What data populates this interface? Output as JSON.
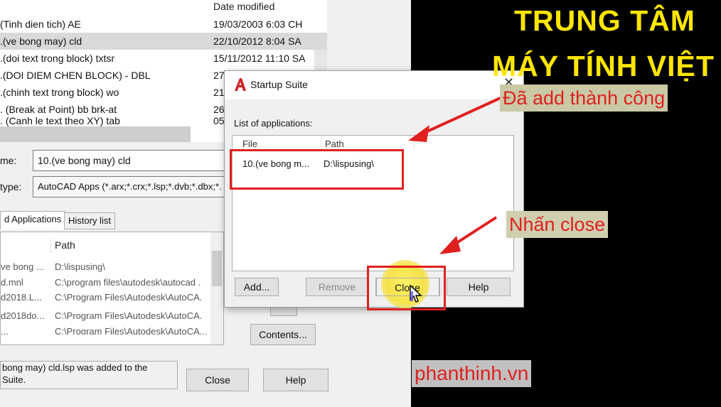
{
  "background_dialog": {
    "table": {
      "date_header": "Date modified",
      "rows": [
        {
          "name": "(Tinh dien tich) AE",
          "date": "19/03/2003 6:03 CH"
        },
        {
          "name": ".(ve bong may) cld",
          "date": "22/10/2012 8:04 SA",
          "selected": true
        },
        {
          "name": ".(doi text trong block) txtsr",
          "date": "15/11/2012 11:10 SA"
        },
        {
          "name": ".(DOI DIEM CHEN BLOCK) - DBL",
          "date": "27"
        },
        {
          "name": ".(chinh text trong block) wo",
          "date": "21"
        },
        {
          "name": ". (Break at Point) bb brk-at",
          "date": "26"
        },
        {
          "name": ". (Canh le text theo XY) tab",
          "date": "05"
        }
      ]
    },
    "file_name_label": "me:",
    "file_name_value": "10.(ve bong may) cld",
    "file_type_label": "type:",
    "file_type_value": "AutoCAD Apps (*.arx;*.crx;*.lsp;*.dvb;*.dbx;*.",
    "tabs": [
      "d Applications",
      "History list"
    ],
    "loaded_list": {
      "path_header": "Path",
      "rows": [
        {
          "name": "ve bong ...",
          "path": "D:\\lispusing\\"
        },
        {
          "name": "d.mnl",
          "path": "C:\\program files\\autodesk\\autocad ."
        },
        {
          "name": "d2018.L...",
          "path": "C:\\Program Files\\Autodesk\\AutoCA."
        },
        {
          "name": "d2018do...",
          "path": "C:\\Program Files\\Autodesk\\AutoCA."
        },
        {
          "name": "...",
          "path": "C:\\Program Files\\Autodesk\\AutoCA..."
        }
      ]
    },
    "contents_button": "Contents...",
    "status_line1": "bong may) cld.lsp was added to the",
    "status_line2": "Suite.",
    "close_button": "Close",
    "help_button": "Help"
  },
  "startup_suite": {
    "title": "Startup Suite",
    "close_glyph": "✕",
    "list_label": "List of applications:",
    "columns": [
      "File",
      "Path"
    ],
    "row": {
      "file": "10.(ve bong m...",
      "path": "D:\\lispusing\\"
    },
    "buttons": {
      "add": "Add...",
      "remove": "Remove",
      "close": "Close",
      "help": "Help"
    }
  },
  "overlays": {
    "brand_line1": "TRUNG TÂM",
    "brand_line2": "MÁY TÍNH VIỆT",
    "annotation_added": "Đã add thành công",
    "annotation_close": "Nhấn close",
    "website": "phanthinh.vn"
  },
  "colors": {
    "accent_red": "#e02020",
    "brand_yellow": "#ffe600"
  }
}
